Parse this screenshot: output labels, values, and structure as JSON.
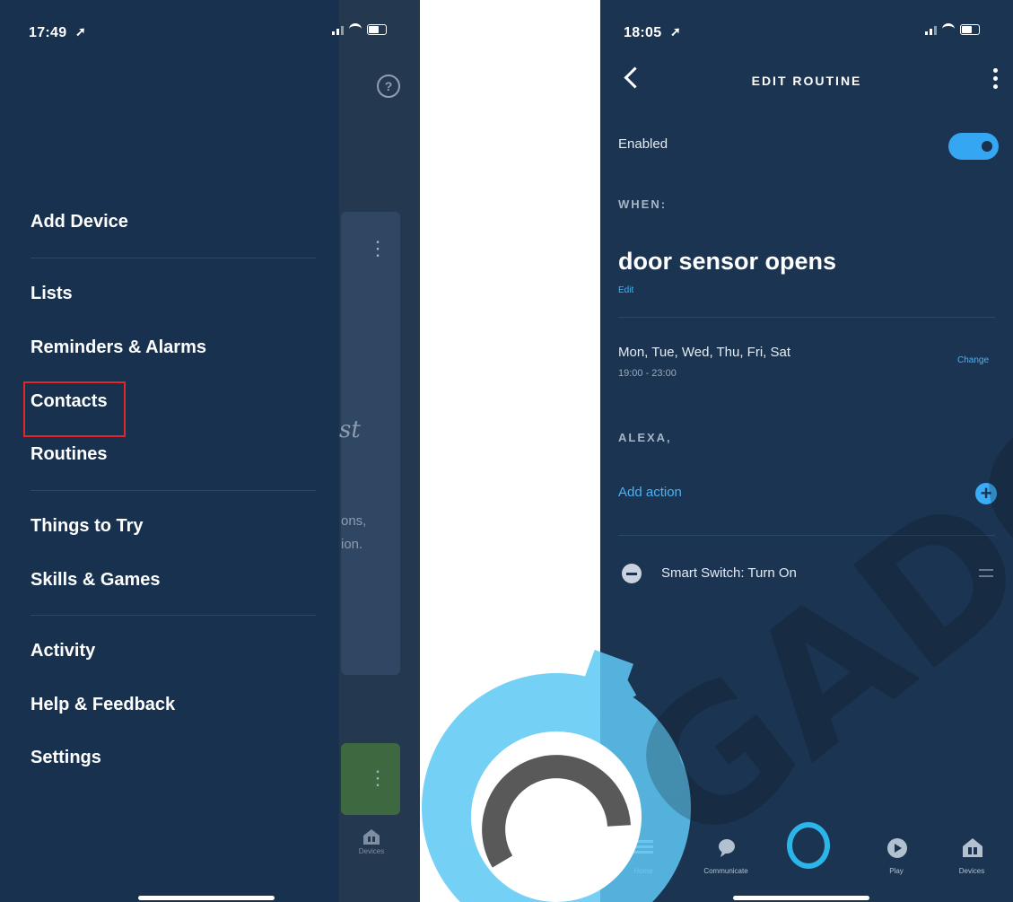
{
  "left_phone": {
    "status_time": "17:49",
    "background": {
      "partial_text_1": "st",
      "partial_text_2": "ons,",
      "partial_text_3": "ion.",
      "devices_label": "Devices"
    },
    "menu": {
      "items": [
        {
          "label": "Add Device"
        },
        {
          "label": "Lists"
        },
        {
          "label": "Reminders & Alarms"
        },
        {
          "label": "Contacts"
        },
        {
          "label": "Routines"
        },
        {
          "label": "Things to Try"
        },
        {
          "label": "Skills & Games"
        },
        {
          "label": "Activity"
        },
        {
          "label": "Help & Feedback"
        },
        {
          "label": "Settings"
        }
      ]
    }
  },
  "right_phone": {
    "status_time": "18:05",
    "header": {
      "title": "EDIT ROUTINE"
    },
    "enabled": {
      "label": "Enabled",
      "state": "on"
    },
    "when": {
      "section_label": "WHEN:",
      "trigger": "door sensor opens",
      "edit_label": "Edit",
      "days": "Mon, Tue, Wed, Thu, Fri, Sat",
      "time_range": "19:00 - 23:00",
      "change_label": "Change"
    },
    "alexa": {
      "section_label": "ALEXA,",
      "add_action_label": "Add action",
      "actions": [
        {
          "label": "Smart Switch: Turn On"
        }
      ]
    },
    "nav": {
      "items": [
        {
          "label": "Home"
        },
        {
          "label": "Communicate"
        },
        {
          "label": "Play"
        },
        {
          "label": "Devices"
        }
      ]
    }
  },
  "colors": {
    "drawer_bg": "#18314f",
    "screen_bg": "#1b3451",
    "accent_blue": "#34a6f2",
    "highlight_red": "#e0282a",
    "watermark_blue": "#5ec8f5"
  },
  "watermark": {
    "text": "GADGET"
  }
}
